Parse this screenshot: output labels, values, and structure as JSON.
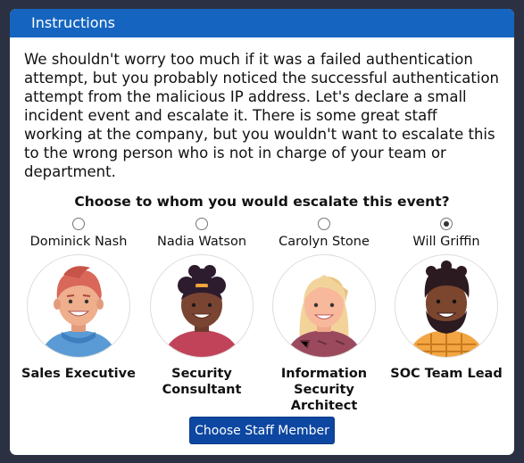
{
  "header": {
    "title": "Instructions"
  },
  "intro_text": "We shouldn't worry too much if it was a failed authentication attempt, but you probably noticed the successful authentication attempt from the malicious IP address. Let's declare a small incident event and escalate it. There is some great staff working at the company, but you wouldn't want to escalate this to the wrong person who is not in charge of your team or department.",
  "question": "Choose to whom you would escalate this event?",
  "staff": [
    {
      "name": "Dominick Nash",
      "role": "Sales Executive",
      "selected": false
    },
    {
      "name": "Nadia Watson",
      "role": "Security Consultant",
      "selected": false
    },
    {
      "name": "Carolyn Stone",
      "role": "Information Security Architect",
      "selected": false
    },
    {
      "name": "Will Griffin",
      "role": "SOC Team Lead",
      "selected": true
    }
  ],
  "button": {
    "label": "Choose Staff Member"
  },
  "colors": {
    "header": "#1565c0",
    "button": "#0d47a1",
    "background": "#2b3142"
  }
}
